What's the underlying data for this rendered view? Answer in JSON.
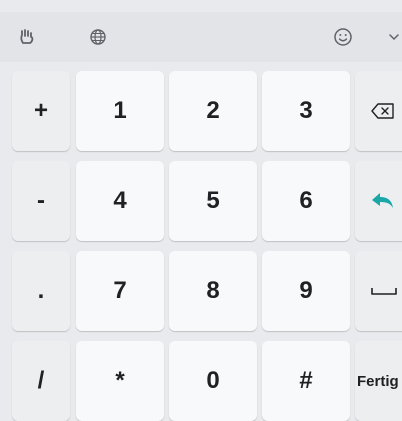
{
  "toolbar": {
    "icons": [
      "hand-wave-icon",
      "globe-icon",
      "emoji-icon",
      "chevron-down-icon"
    ]
  },
  "keys": {
    "row1": [
      "+",
      "1",
      "2",
      "3"
    ],
    "row2": [
      "-",
      "4",
      "5",
      "6"
    ],
    "row3": [
      ".",
      "7",
      "8",
      "9"
    ],
    "row4": [
      "/",
      "*",
      "0",
      "#"
    ]
  },
  "function_keys": {
    "backspace": "backspace-icon",
    "enter": "enter-icon",
    "space": "space-icon",
    "done_label": "Fertig"
  },
  "colors": {
    "background": "#e8eaed",
    "key": "#f8f9fa",
    "symbol_key": "#eceef0",
    "enter_accent": "#1aa7a8",
    "text": "#202124"
  }
}
